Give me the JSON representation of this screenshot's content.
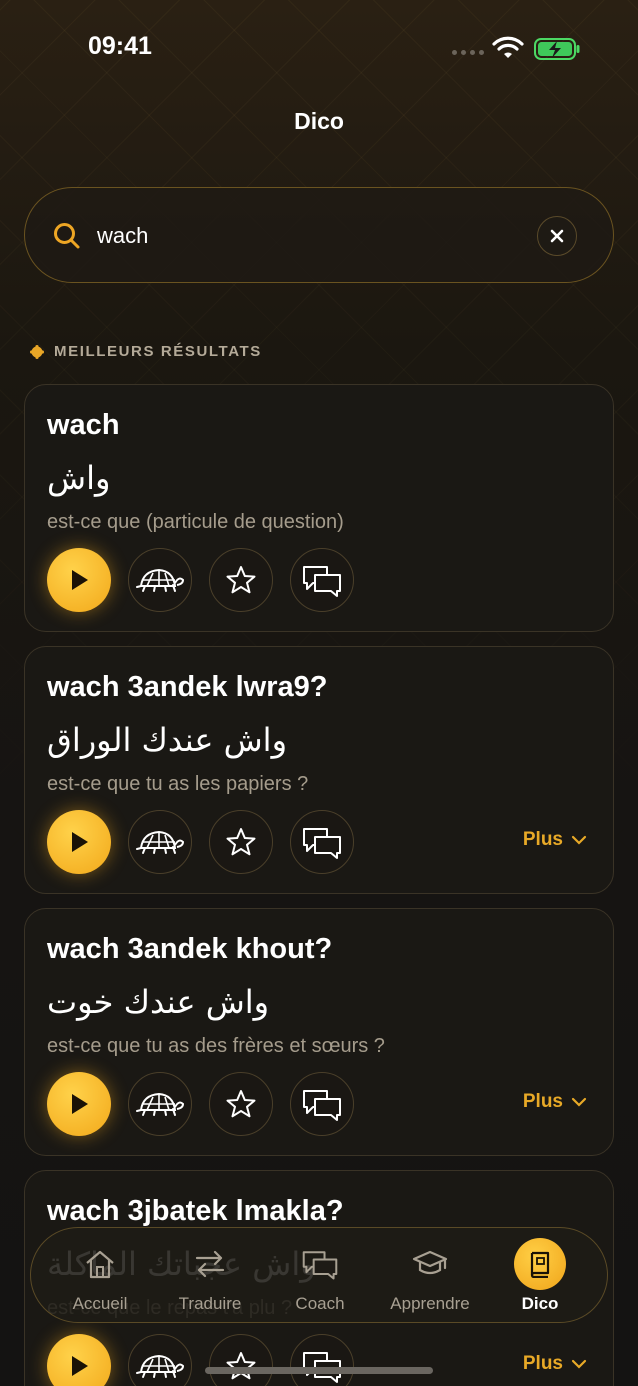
{
  "status_bar": {
    "time": "09:41"
  },
  "header": {
    "title": "Dico"
  },
  "search": {
    "value": "wach",
    "placeholder": ""
  },
  "section": {
    "label": "MEILLEURS RÉSULTATS"
  },
  "results": [
    {
      "term": "wach",
      "arabic": "واش",
      "meaning": "est-ce que (particule de question)",
      "more_label": ""
    },
    {
      "term": "wach 3andek lwra9?",
      "arabic": "واش عندك الوراق",
      "meaning": "est-ce que tu as les papiers ?",
      "more_label": "Plus"
    },
    {
      "term": "wach 3andek khout?",
      "arabic": "واش عندك خوت",
      "meaning": "est-ce que tu as des frères et sœurs ?",
      "more_label": "Plus"
    },
    {
      "term": "wach 3jbatek lmakla?",
      "arabic": "واش عجباتك الماكلة",
      "meaning": "est-ce que le repas t'a plu ?",
      "more_label": "Plus"
    }
  ],
  "tabs": [
    {
      "label": "Accueil",
      "icon": "home-icon"
    },
    {
      "label": "Traduire",
      "icon": "swap-icon"
    },
    {
      "label": "Coach",
      "icon": "chat-icon"
    },
    {
      "label": "Apprendre",
      "icon": "graduation-cap-icon"
    },
    {
      "label": "Dico",
      "icon": "book-icon",
      "active": true
    }
  ],
  "colors": {
    "accent": "#F2A81A",
    "background": "#161412",
    "card": "#1A1815"
  }
}
